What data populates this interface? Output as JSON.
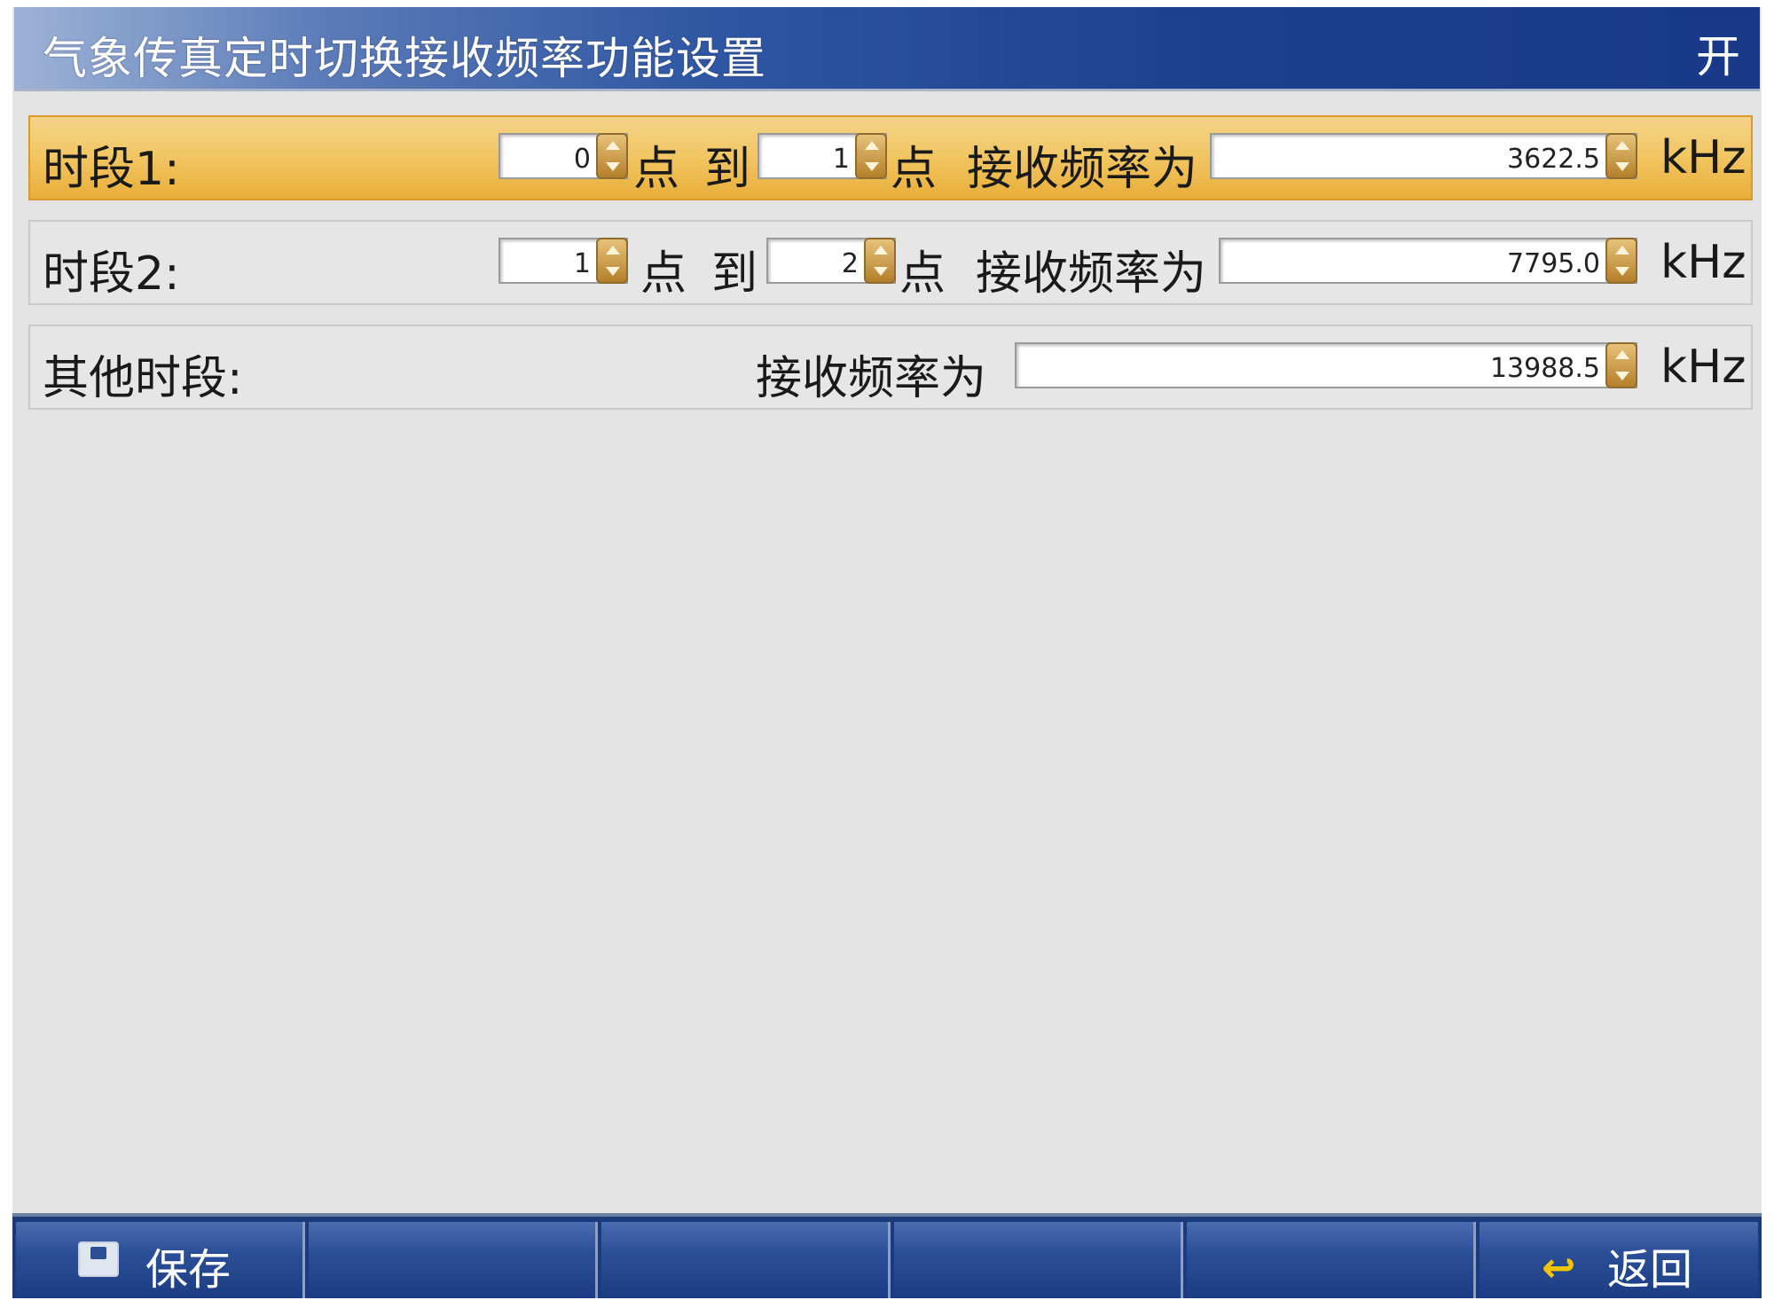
{
  "header": {
    "title": "气象传真定时切换接收频率功能设置",
    "status": "开"
  },
  "rows": [
    {
      "label": "时段1:",
      "from": "0",
      "text_from": "点",
      "text_to": "到",
      "to": "1",
      "text_hour": "点",
      "text_freq": "接收频率为",
      "freq": "3622.5",
      "unit": "kHz"
    },
    {
      "label": "时段2:",
      "from": "1",
      "text_from": "点",
      "text_to": "到",
      "to": "2",
      "text_hour": "点",
      "text_freq": "接收频率为",
      "freq": "7795.0",
      "unit": "kHz"
    },
    {
      "label": "其他时段:",
      "text_freq": "接收频率为",
      "freq": "13988.5",
      "unit": "kHz"
    }
  ],
  "toolbar": {
    "save": "保存",
    "back": "返回",
    "save_icon": "save-icon",
    "back_icon": "back-arrow-icon"
  },
  "colors": {
    "title_bar": "#1b3f8d",
    "selected_row": "#f2c765",
    "toolbar": "#1c3b7c",
    "accent_arrow": "#f5c400"
  }
}
